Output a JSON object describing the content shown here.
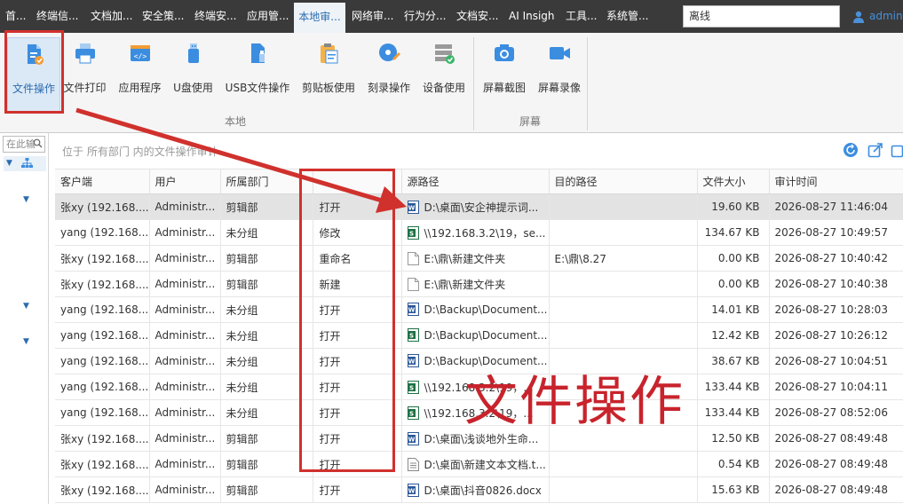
{
  "topnav": {
    "items": [
      "首...",
      "终端信...",
      "文档加...",
      "安全策...",
      "终端安...",
      "应用管...",
      "本地审...",
      "网络审...",
      "行为分...",
      "文档安...",
      "AI Insigh",
      "工具...",
      "系统管..."
    ],
    "search_value": "离线",
    "user": "admin"
  },
  "ribbon": {
    "buttons": [
      {
        "label": "文件操作",
        "icon": "file-operation-icon"
      },
      {
        "label": "文件打印",
        "icon": "printer-icon"
      },
      {
        "label": "应用程序",
        "icon": "application-icon"
      },
      {
        "label": "U盘使用",
        "icon": "usb-drive-icon"
      },
      {
        "label": "USB文件操作",
        "icon": "usb-file-icon"
      },
      {
        "label": "剪贴板使用",
        "icon": "clipboard-icon"
      },
      {
        "label": "刻录操作",
        "icon": "disc-burn-icon"
      },
      {
        "label": "设备使用",
        "icon": "device-icon"
      },
      {
        "label": "屏幕截图",
        "icon": "camera-icon"
      },
      {
        "label": "屏幕录像",
        "icon": "video-icon"
      }
    ],
    "groups": {
      "local": "本地",
      "screen": "屏幕"
    }
  },
  "sidebar": {
    "search_placeholder": "在此输"
  },
  "main": {
    "breadcrumb": "位于 所有部门 内的文件操作审计",
    "columns": [
      "客户端",
      "用户",
      "所属部门",
      "",
      "源路径",
      "目的路径",
      "文件大小",
      "审计时间"
    ],
    "rows": [
      {
        "client": "张xy (192.168....",
        "user": "Administr...",
        "dept": "剪辑部",
        "op": "打开",
        "icon": "word",
        "src": "D:\\桌面\\安企神提示词...",
        "dst": "",
        "size": "19.60 KB",
        "time": "2026-08-27 11:46:04"
      },
      {
        "client": "yang (192.168....",
        "user": "Administr...",
        "dept": "未分组",
        "op": "修改",
        "icon": "excel",
        "src": "\\\\192.168.3.2\\19，se...",
        "dst": "",
        "size": "134.67 KB",
        "time": "2026-08-27 10:49:57"
      },
      {
        "client": "张xy (192.168....",
        "user": "Administr...",
        "dept": "剪辑部",
        "op": "重命名",
        "icon": "blank",
        "src": "E:\\鼎\\新建文件夹",
        "dst": "E:\\鼎\\8.27",
        "size": "0.00 KB",
        "time": "2026-08-27 10:40:42"
      },
      {
        "client": "张xy (192.168....",
        "user": "Administr...",
        "dept": "剪辑部",
        "op": "新建",
        "icon": "blank",
        "src": "E:\\鼎\\新建文件夹",
        "dst": "",
        "size": "0.00 KB",
        "time": "2026-08-27 10:40:38"
      },
      {
        "client": "yang (192.168....",
        "user": "Administr...",
        "dept": "未分组",
        "op": "打开",
        "icon": "word",
        "src": "D:\\Backup\\Document...",
        "dst": "",
        "size": "14.01 KB",
        "time": "2026-08-27 10:28:03"
      },
      {
        "client": "yang (192.168....",
        "user": "Administr...",
        "dept": "未分组",
        "op": "打开",
        "icon": "excel",
        "src": "D:\\Backup\\Document...",
        "dst": "",
        "size": "12.42 KB",
        "time": "2026-08-27 10:26:12"
      },
      {
        "client": "yang (192.168....",
        "user": "Administr...",
        "dept": "未分组",
        "op": "打开",
        "icon": "word",
        "src": "D:\\Backup\\Document...",
        "dst": "",
        "size": "38.67 KB",
        "time": "2026-08-27 10:04:51"
      },
      {
        "client": "yang (192.168....",
        "user": "Administr...",
        "dept": "未分组",
        "op": "打开",
        "icon": "excel",
        "src": "\\\\192.168.3.2\\19，...",
        "dst": "",
        "size": "133.44 KB",
        "time": "2026-08-27 10:04:11"
      },
      {
        "client": "yang (192.168....",
        "user": "Administr...",
        "dept": "未分组",
        "op": "打开",
        "icon": "excel",
        "src": "\\\\192.168.3.2\\19，...",
        "dst": "",
        "size": "133.44 KB",
        "time": "2026-08-27 08:52:06"
      },
      {
        "client": "张xy (192.168....",
        "user": "Administr...",
        "dept": "剪辑部",
        "op": "打开",
        "icon": "word",
        "src": "D:\\桌面\\浅谈地外生命...",
        "dst": "",
        "size": "12.50 KB",
        "time": "2026-08-27 08:49:48"
      },
      {
        "client": "张xy (192.168....",
        "user": "Administr...",
        "dept": "剪辑部",
        "op": "打开",
        "icon": "text",
        "src": "D:\\桌面\\新建文本文档.t...",
        "dst": "",
        "size": "0.54 KB",
        "time": "2026-08-27 08:49:48"
      },
      {
        "client": "张xy (192.168....",
        "user": "Administr...",
        "dept": "剪辑部",
        "op": "打开",
        "icon": "word",
        "src": "D:\\桌面\\抖音0826.docx",
        "dst": "",
        "size": "15.63 KB",
        "time": "2026-08-27 08:49:48"
      }
    ]
  },
  "annotation": {
    "text": "文件操作"
  },
  "colors": {
    "accent": "#2b6cb0",
    "annotation_red": "#d0312d",
    "nav_bg": "#3a3a3a"
  }
}
